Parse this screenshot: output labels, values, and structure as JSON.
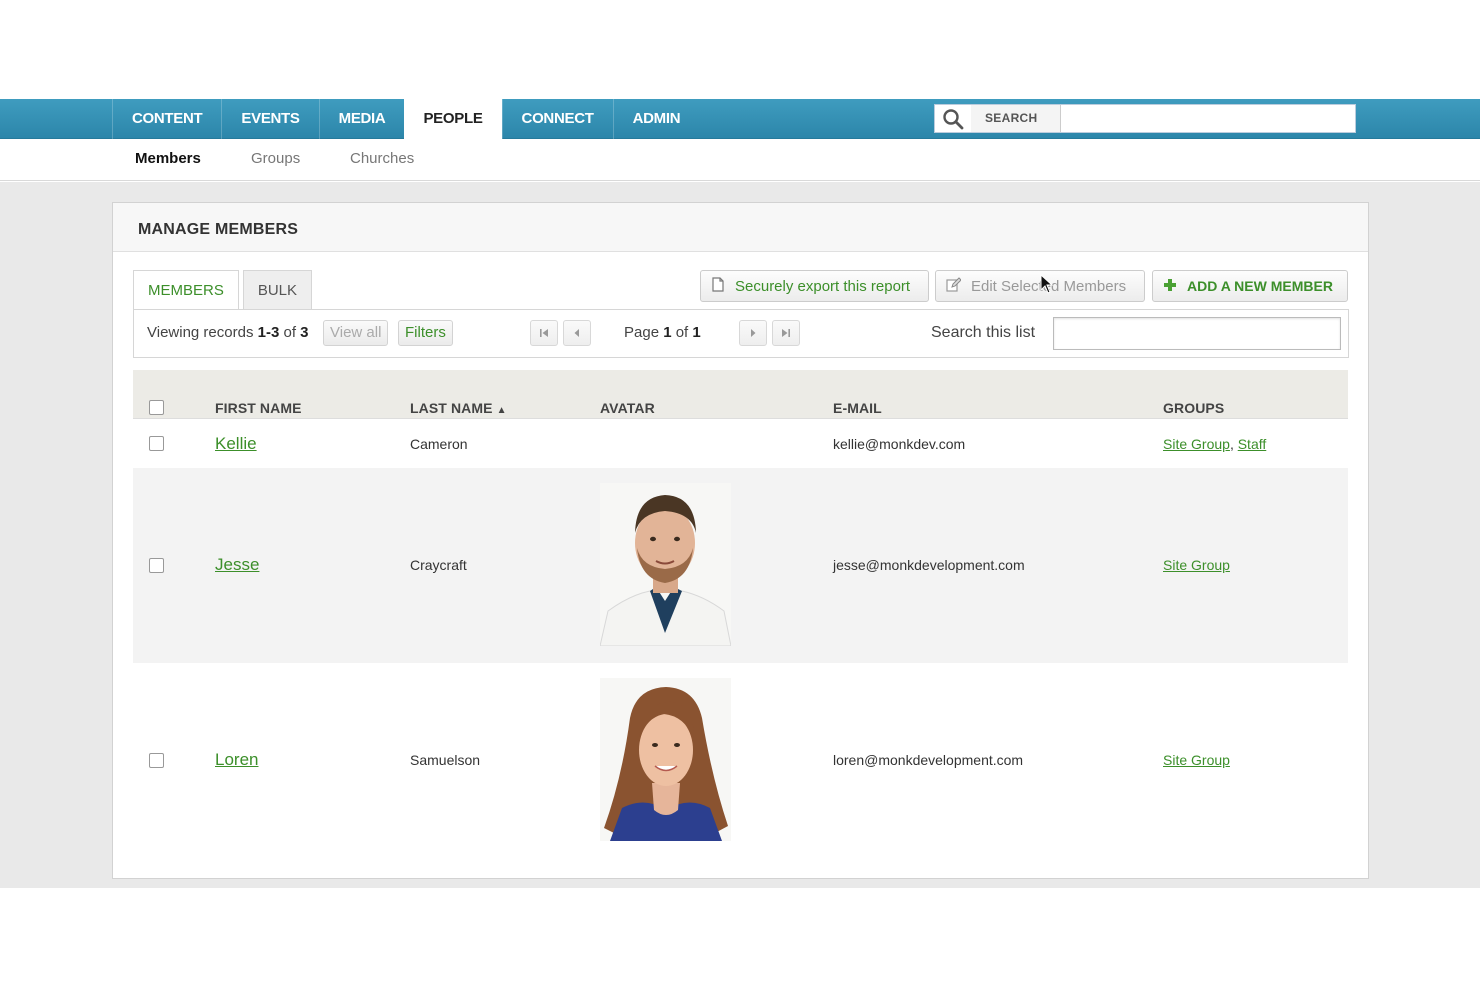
{
  "top_nav": {
    "tabs": [
      "CONTENT",
      "EVENTS",
      "MEDIA",
      "PEOPLE",
      "CONNECT",
      "ADMIN"
    ],
    "active_tab": "PEOPLE",
    "search_label": "SEARCH",
    "search_value": ""
  },
  "sub_nav": {
    "items": [
      "Members",
      "Groups",
      "Churches"
    ],
    "active": "Members"
  },
  "panel": {
    "title": "MANAGE MEMBERS",
    "tabs": [
      "MEMBERS",
      "BULK"
    ],
    "active_tab": "MEMBERS",
    "buttons": {
      "export": "Securely export this report",
      "edit": "Edit Selected Members",
      "add": "ADD A NEW MEMBER"
    },
    "list_bar": {
      "viewing_prefix": "Viewing records ",
      "viewing_range": "1-3",
      "viewing_of": " of ",
      "viewing_total": "3",
      "view_all": "View all",
      "filters": "Filters",
      "page_prefix": "Page ",
      "page_current": "1",
      "page_of": " of ",
      "page_total": "1",
      "search_label": "Search this list",
      "search_value": ""
    }
  },
  "table": {
    "columns": [
      "FIRST NAME",
      "LAST NAME",
      "AVATAR",
      "E-MAIL",
      "GROUPS"
    ],
    "sort_indicator": "▲",
    "rows": [
      {
        "first_name": "Kellie",
        "last_name": "Cameron",
        "email": "kellie@monkdev.com",
        "groups": [
          "Site Group",
          "Staff"
        ],
        "avatar": "none"
      },
      {
        "first_name": "Jesse",
        "last_name": "Craycraft",
        "email": "jesse@monkdevelopment.com",
        "groups": [
          "Site Group"
        ],
        "avatar": "man-photo"
      },
      {
        "first_name": "Loren",
        "last_name": "Samuelson",
        "email": "loren@monkdevelopment.com",
        "groups": [
          "Site Group"
        ],
        "avatar": "woman-photo"
      }
    ]
  },
  "colors": {
    "nav_blue": "#2c86aa",
    "link_green": "#3c8f2a"
  }
}
